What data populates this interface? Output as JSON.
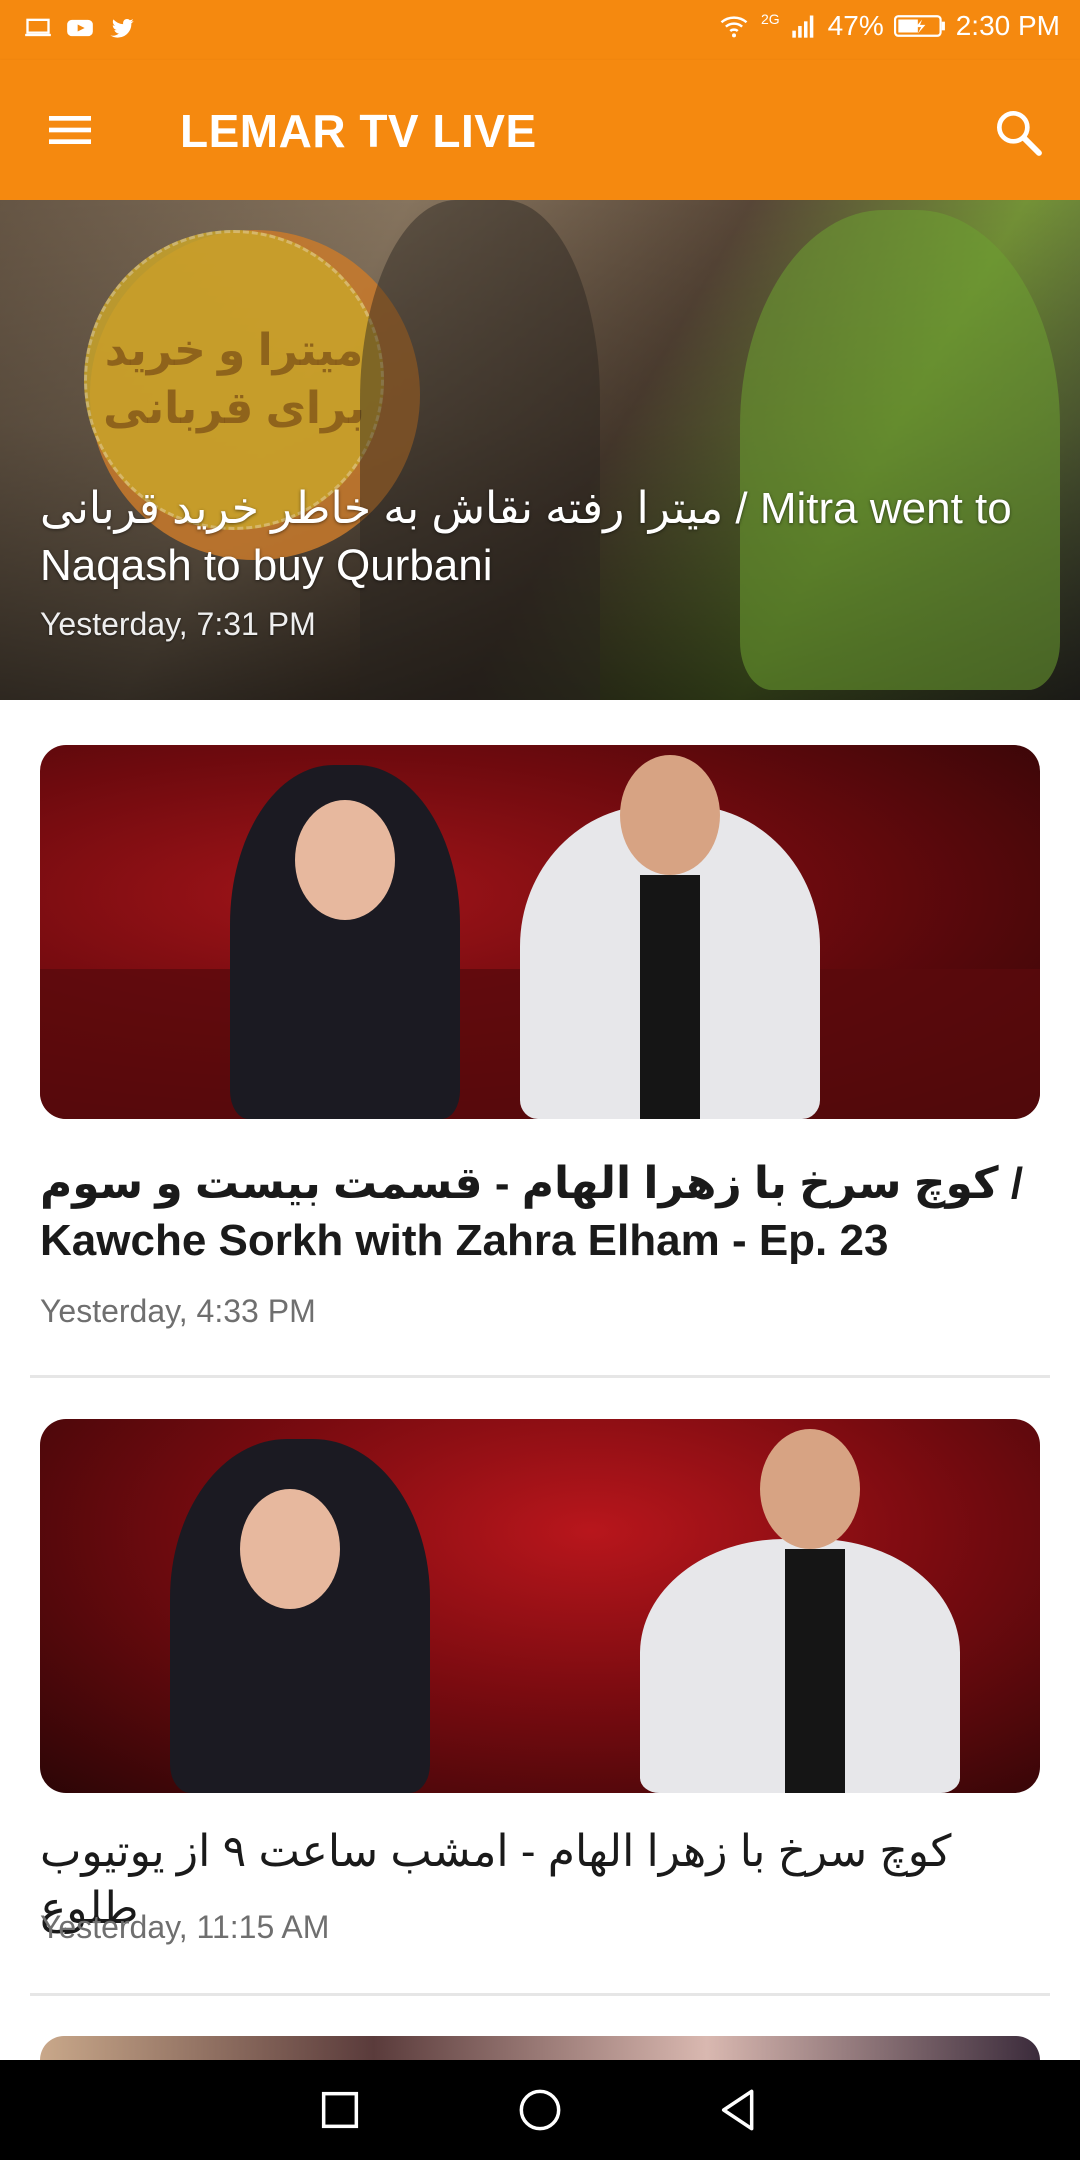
{
  "status_bar": {
    "left_icons": [
      "laptop-icon",
      "youtube-icon",
      "twitter-icon"
    ],
    "network_label": "2G",
    "battery_percent": "47%",
    "time": "2:30 PM"
  },
  "app_bar": {
    "title": "LEMAR TV LIVE",
    "menu_icon": "hamburger-menu-icon",
    "search_icon": "search-icon"
  },
  "featured": {
    "badge_text": "میترا و خرید برای قربانی",
    "title": "میترا رفته نقاش به خاطر خرید قربانی / Mitra went to Naqash to buy Qurbani",
    "time": "Yesterday, 7:31 PM"
  },
  "feed": [
    {
      "title": "کوچ سرخ با زهرا الهام - قسمت بیست و سوم / Kawche Sorkh with Zahra Elham  - Ep. 23",
      "time": "Yesterday, 4:33 PM"
    },
    {
      "title": "کوچ سرخ با زهرا الهام - امشب ساعت ۹ از یوتیوب طلوع",
      "time": "Yesterday, 11:15 AM"
    }
  ],
  "nav_bar": {
    "buttons": [
      "recent-apps-icon",
      "home-icon",
      "back-icon"
    ]
  },
  "colors": {
    "brand": "#F5890F",
    "text_primary": "#1a1a1a",
    "text_secondary": "#6f6f6f"
  }
}
